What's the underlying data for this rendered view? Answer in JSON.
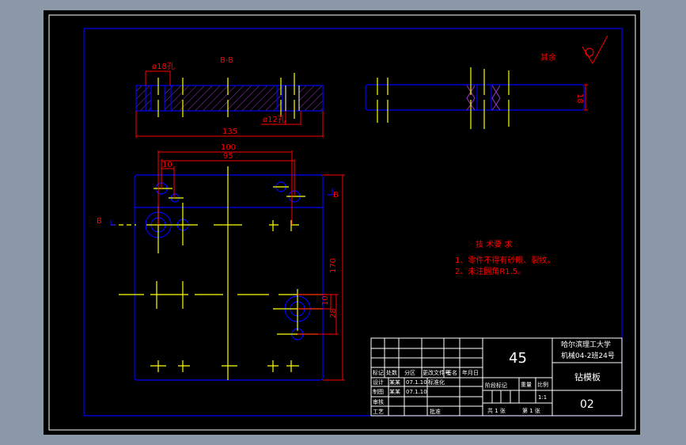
{
  "colors": {
    "background": "#8a98a8",
    "canvas": "#000000",
    "outline": "#0000ff",
    "centerline": "#ffff00",
    "dimension": "#ff0000",
    "hatch": "#9933cc",
    "frame": "#ffffff"
  },
  "section": {
    "title": "B-B",
    "hole_a": "ø18孔",
    "hole_b": "ø12孔",
    "length": "135"
  },
  "side_view": {
    "thickness": "18"
  },
  "roughness": {
    "label": "其余",
    "icon": "surface-roughness-icon"
  },
  "main_view": {
    "dim_100": "100",
    "dim_95": "95",
    "dim_10_top": "10",
    "dim_170": "170",
    "dim_10_right": "10",
    "dim_28": "28",
    "section_mark_left": "B",
    "section_mark_right": "B"
  },
  "tech": {
    "title": "技 术要 求",
    "items": [
      "1、零件不得有砂眼、裂纹。",
      "2、未注圆角R1.5。"
    ]
  },
  "title_block": {
    "material": "45",
    "school": "哈尔滨理工大学",
    "class": "机械04-2班24号",
    "part_name": "钻模板",
    "drawing_no": "02",
    "headers": [
      "标记",
      "处数",
      "分区",
      "更改文件号",
      "签名",
      "年月日"
    ],
    "rows": [
      {
        "label": "设计",
        "name": "某某",
        "date": "07.1.10",
        "extra": "标准化"
      },
      {
        "label": "制图",
        "name": "某某",
        "date": "07.1.10",
        "extra": ""
      },
      {
        "label": "审核",
        "name": "",
        "date": "",
        "extra": ""
      },
      {
        "label": "工艺",
        "name": "",
        "date": "",
        "extra": "批准"
      }
    ],
    "stage_label": "阶段标记",
    "weight_label": "重量",
    "scale_label": "比例",
    "scale": "1:1",
    "sheets_total": "共 1 张",
    "sheet_no": "第 1 张"
  }
}
